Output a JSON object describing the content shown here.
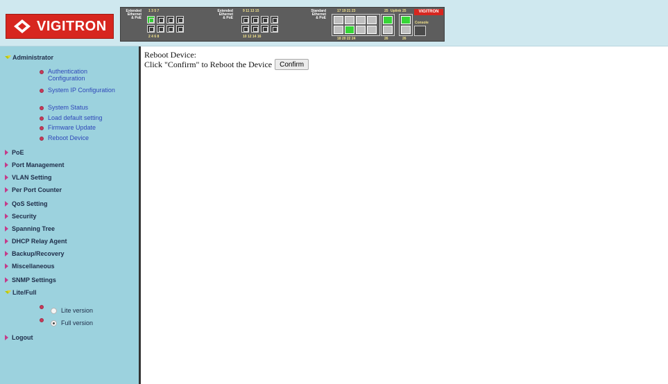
{
  "brand": {
    "name": "VIGITRON"
  },
  "switch_panel": {
    "group1_label": [
      "Extended",
      "Ethernet",
      "& PoE"
    ],
    "group2_label": [
      "Extended",
      "Ethernet",
      "& PoE"
    ],
    "group3_label": [
      "Standard",
      "Ethernet",
      "& PoE"
    ],
    "top_numbers_g1": "1  3  5  7",
    "bottom_numbers_g1": "2  4  6  8",
    "top_numbers_g2": "9  11  13  15",
    "bottom_numbers_g2": "10  12  14  16",
    "top_numbers_g3": "17  19  21  23",
    "bottom_numbers_g3": "18  20  22  24",
    "uplink_label": "Uplink",
    "uplink_top": "25",
    "uplink_bottom": "26",
    "uplink_extra_top": "25",
    "uplink_extra_bottom": "26",
    "console_label": "Console",
    "logo_text": "VIGITRON"
  },
  "sidebar": {
    "administrator": "Administrator",
    "admin_items": [
      {
        "label": "Authentication Configuration"
      },
      {
        "label": "System IP Configuration"
      },
      {
        "label": "System Status"
      },
      {
        "label": "Load default setting"
      },
      {
        "label": "Firmware Update"
      },
      {
        "label": "Reboot Device"
      }
    ],
    "sections": [
      "PoE",
      "Port Management",
      "VLAN Setting",
      "Per Port Counter",
      "QoS Setting",
      "Security",
      "Spanning Tree",
      "DHCP Relay Agent",
      "Backup/Recovery",
      "Miscellaneous",
      "SNMP Settings"
    ],
    "lite_full": "Lite/Full",
    "lite_version": "Lite version",
    "full_version": "Full version",
    "logout": "Logout"
  },
  "main": {
    "title": "Reboot Device:",
    "instruction": "Click \"Confirm\" to Reboot the Device",
    "confirm_label": "Confirm"
  },
  "colors": {
    "header_bg": "#cfe8ef",
    "sidebar_bg": "#9cd2de",
    "brand_red": "#d7261f",
    "link_blue": "#2f47b8",
    "port_active": "#33cc33"
  }
}
